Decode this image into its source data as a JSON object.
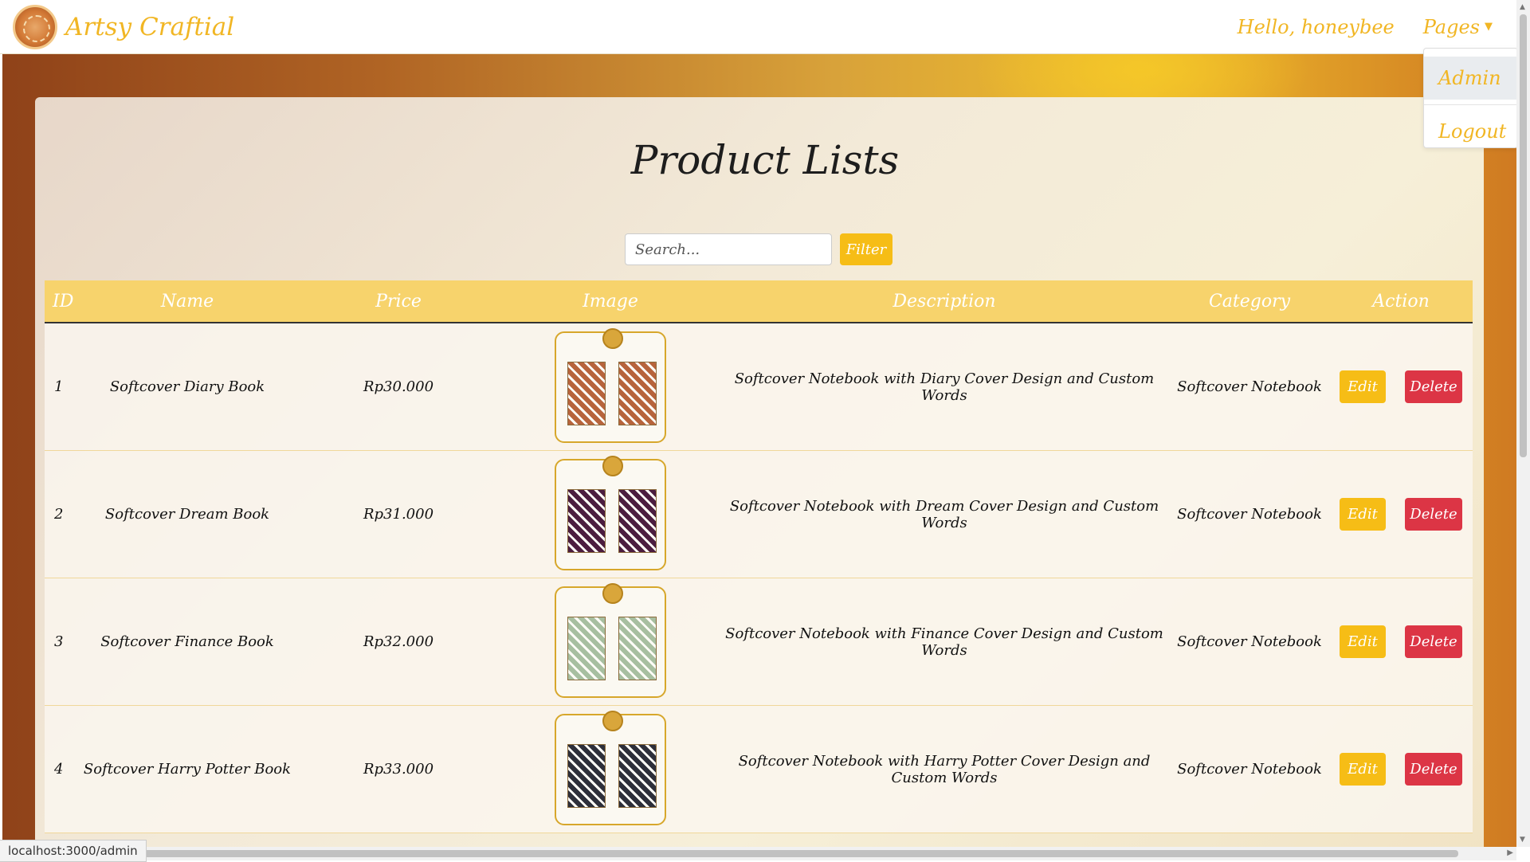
{
  "navbar": {
    "brand": "Artsy Craftial",
    "greeting": "Hello, honeybee",
    "pages_label": "Pages",
    "dropdown": [
      "Admin",
      "Logout"
    ]
  },
  "page": {
    "title": "Product Lists",
    "search_placeholder": "Search...",
    "filter_label": "Filter"
  },
  "table": {
    "headers": [
      "ID",
      "Name",
      "Price",
      "Image",
      "Description",
      "Category",
      "Action"
    ],
    "rows": [
      {
        "id": "1",
        "name": "Softcover Diary Book",
        "price": "Rp30.000",
        "description": "Softcover Notebook with Diary Cover Design and Custom Words",
        "category": "Softcover Notebook",
        "edit": "Edit",
        "delete": "Delete",
        "theme": "#b7643c"
      },
      {
        "id": "2",
        "name": "Softcover Dream Book",
        "price": "Rp31.000",
        "description": "Softcover Notebook with Dream Cover Design and Custom Words",
        "category": "Softcover Notebook",
        "edit": "Edit",
        "delete": "Delete",
        "theme": "#4b1d3f"
      },
      {
        "id": "3",
        "name": "Softcover Finance Book",
        "price": "Rp32.000",
        "description": "Softcover Notebook with Finance Cover Design and Custom Words",
        "category": "Softcover Notebook",
        "edit": "Edit",
        "delete": "Delete",
        "theme": "#a7bfa0"
      },
      {
        "id": "4",
        "name": "Softcover Harry Potter Book",
        "price": "Rp33.000",
        "description": "Softcover Notebook with Harry Potter Cover Design and Custom Words",
        "category": "Softcover Notebook",
        "edit": "Edit",
        "delete": "Delete",
        "theme": "#2d2f3a"
      }
    ]
  },
  "statusbar": {
    "url": "localhost:3000/admin"
  },
  "colors": {
    "accent": "#f6bd16",
    "danger": "#dc3545",
    "header_bg": "#f7d36c"
  }
}
